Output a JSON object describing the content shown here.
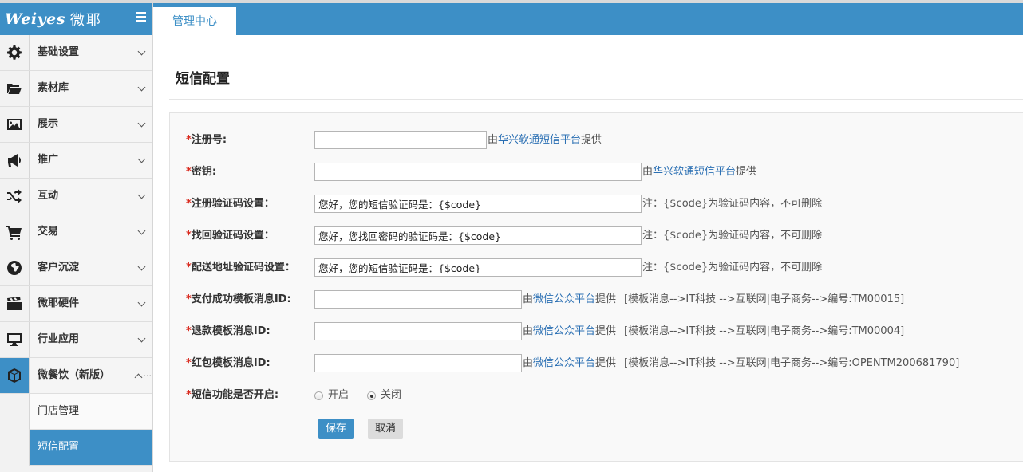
{
  "brand": {
    "logo": "Weiyes",
    "logo_cn": "微耶"
  },
  "sidebar": {
    "items": [
      {
        "label": "基础设置",
        "icon": "gear-icon"
      },
      {
        "label": "素材库",
        "icon": "folder-open-icon"
      },
      {
        "label": "展示",
        "icon": "picture-icon"
      },
      {
        "label": "推广",
        "icon": "bullhorn-icon"
      },
      {
        "label": "互动",
        "icon": "shuffle-icon"
      },
      {
        "label": "交易",
        "icon": "shopping-cart-icon"
      },
      {
        "label": "客户沉淀",
        "icon": "globe-icon"
      },
      {
        "label": "微耶硬件",
        "icon": "film-icon"
      },
      {
        "label": "行业应用",
        "icon": "desktop-icon"
      },
      {
        "label": "微餐饮（新版）",
        "icon": "cube-icon",
        "overflow": "..."
      }
    ],
    "sub_items": [
      {
        "label": "门店管理"
      },
      {
        "label": "短信配置"
      }
    ]
  },
  "tabs": [
    {
      "label": "管理中心"
    }
  ],
  "page": {
    "title": "短信配置"
  },
  "form": {
    "required_mark": "*",
    "reg_no": {
      "label": "注册号:",
      "value": "",
      "by": "由",
      "link": "华兴软通短信平台",
      "provide": "提供"
    },
    "secret": {
      "label": "密钥:",
      "value": "",
      "by": "由",
      "link": "华兴软通短信平台",
      "provide": "提供"
    },
    "reg_code": {
      "label": "注册验证码设置：",
      "value": "您好，您的短信验证码是：{$code}",
      "note": "注：{$code}为验证码内容，不可删除"
    },
    "recover_code": {
      "label": "找回验证码设置：",
      "value": "您好，您找回密码的验证码是：{$code}",
      "note": "注：{$code}为验证码内容，不可删除"
    },
    "address_code": {
      "label": "配送地址验证码设置：",
      "value": "您好，您的短信验证码是：{$code}",
      "note": "注：{$code}为验证码内容，不可删除"
    },
    "pay_tpl": {
      "label": "支付成功模板消息ID:",
      "value": "",
      "by": "由",
      "link": "微信公众平台",
      "provide": "提供",
      "tpl": "[模板消息-->IT科技 -->互联网|电子商务-->编号:TM00015]"
    },
    "refund_tpl": {
      "label": "退款模板消息ID:",
      "value": "",
      "by": "由",
      "link": "微信公众平台",
      "provide": "提供",
      "tpl": "[模板消息-->IT科技 -->互联网|电子商务-->编号:TM00004]"
    },
    "redpack_tpl": {
      "label": "红包模板消息ID:",
      "value": "",
      "by": "由",
      "link": "微信公众平台",
      "provide": "提供",
      "tpl": "[模板消息-->IT科技 -->互联网|电子商务-->编号:OPENTM200681790]"
    },
    "sms_enable": {
      "label": "短信功能是否开启:",
      "on": "开启",
      "off": "关闭",
      "selected": "关闭"
    },
    "save_label": "保存",
    "cancel_label": "取消"
  },
  "colors": {
    "brand_blue": "#3d8fc6",
    "required_red": "#d9281c",
    "link_blue": "#2a6fb3"
  }
}
